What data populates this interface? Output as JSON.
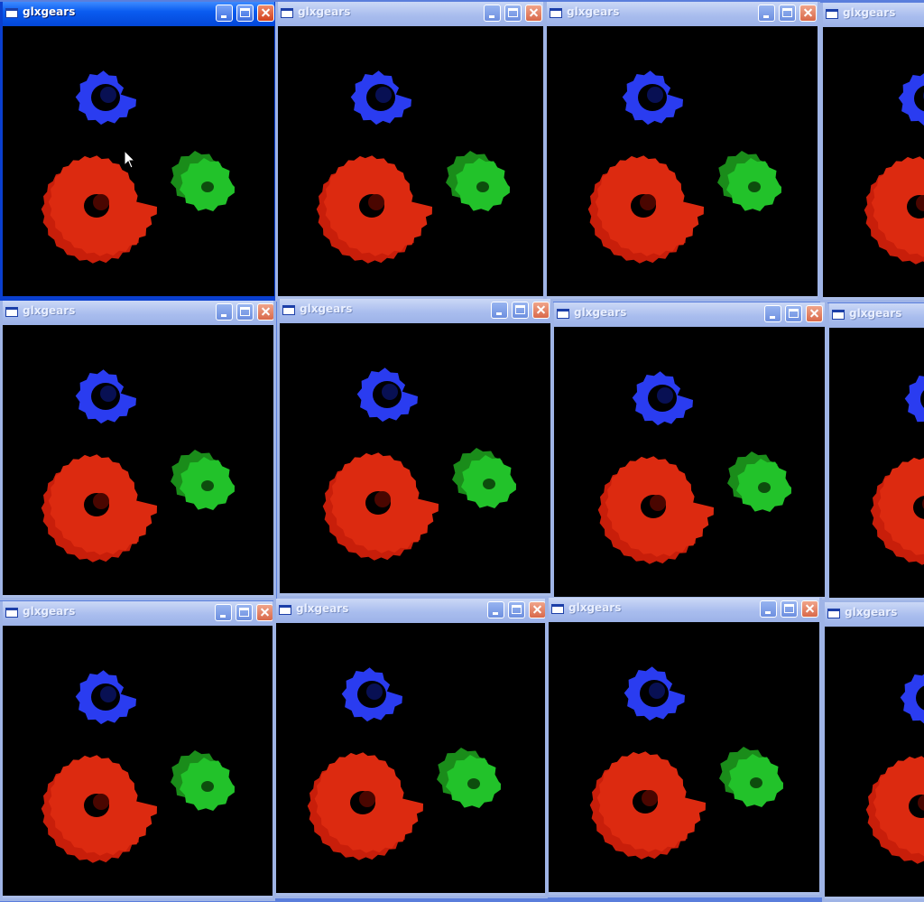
{
  "app_title": "glxgears",
  "icons": {
    "system": "window-icon",
    "minimize": "minimize-icon",
    "maximize": "maximize-icon",
    "close": "close-icon",
    "cursor": "arrow-cursor-icon"
  },
  "colors": {
    "desktop": "#5a7edc",
    "active_titlebar": "#0a5cf0",
    "inactive_titlebar": "#a9bdee",
    "red_gear": "#c81e0a",
    "green_gear": "#22c22a",
    "blue_gear": "#2a3cf0",
    "client_background": "#000000"
  },
  "windows": [
    {
      "title": "glxgears",
      "active": true
    },
    {
      "title": "glxgears",
      "active": false
    },
    {
      "title": "glxgears",
      "active": false
    },
    {
      "title": "glxgears",
      "active": false
    },
    {
      "title": "glxgears",
      "active": false
    },
    {
      "title": "glxgears",
      "active": false
    },
    {
      "title": "glxgears",
      "active": false
    },
    {
      "title": "glxgears",
      "active": false
    },
    {
      "title": "glxgears",
      "active": false
    },
    {
      "title": "glxgears",
      "active": false
    },
    {
      "title": "glxgears",
      "active": false
    },
    {
      "title": "glxgears",
      "active": false
    }
  ]
}
